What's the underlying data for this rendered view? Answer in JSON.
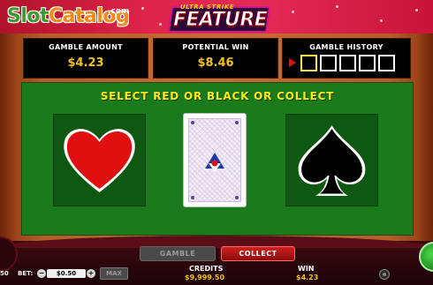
{
  "watermark": {
    "slot": "Slot",
    "catalog": "Catalog",
    "com": ".com"
  },
  "logo": {
    "small": "ULTRA STRIKE",
    "big": "FEATURE"
  },
  "meters": {
    "gamble_amount": {
      "label": "GAMBLE AMOUNT",
      "value": "$4.23"
    },
    "potential_win": {
      "label": "POTENTIAL WIN",
      "value": "$8.46"
    },
    "gamble_history": {
      "label": "GAMBLE HISTORY",
      "slots": 5
    }
  },
  "instruction": "SELECT RED OR BLACK OR COLLECT",
  "choices": {
    "red": {
      "icon": "heart-icon",
      "color": "#e01010"
    },
    "card": {
      "icon": "card-back-icon"
    },
    "black": {
      "icon": "spade-icon",
      "color": "#000000"
    }
  },
  "buttons": {
    "gamble": "GAMBLE",
    "collect": "COLLECT",
    "max": "MAX",
    "minus": "−",
    "plus": "+"
  },
  "bottom": {
    "left_partial": "50",
    "bet_label": "BET:",
    "bet_value": "$0.50",
    "credits_label": "CREDITS",
    "credits_value": "$9,999.50",
    "win_label": "WIN",
    "win_value": "$4.23"
  },
  "colors": {
    "felt": "#1b7a1c",
    "meter_value": "#f2c21a",
    "accent_red": "#d02020"
  }
}
